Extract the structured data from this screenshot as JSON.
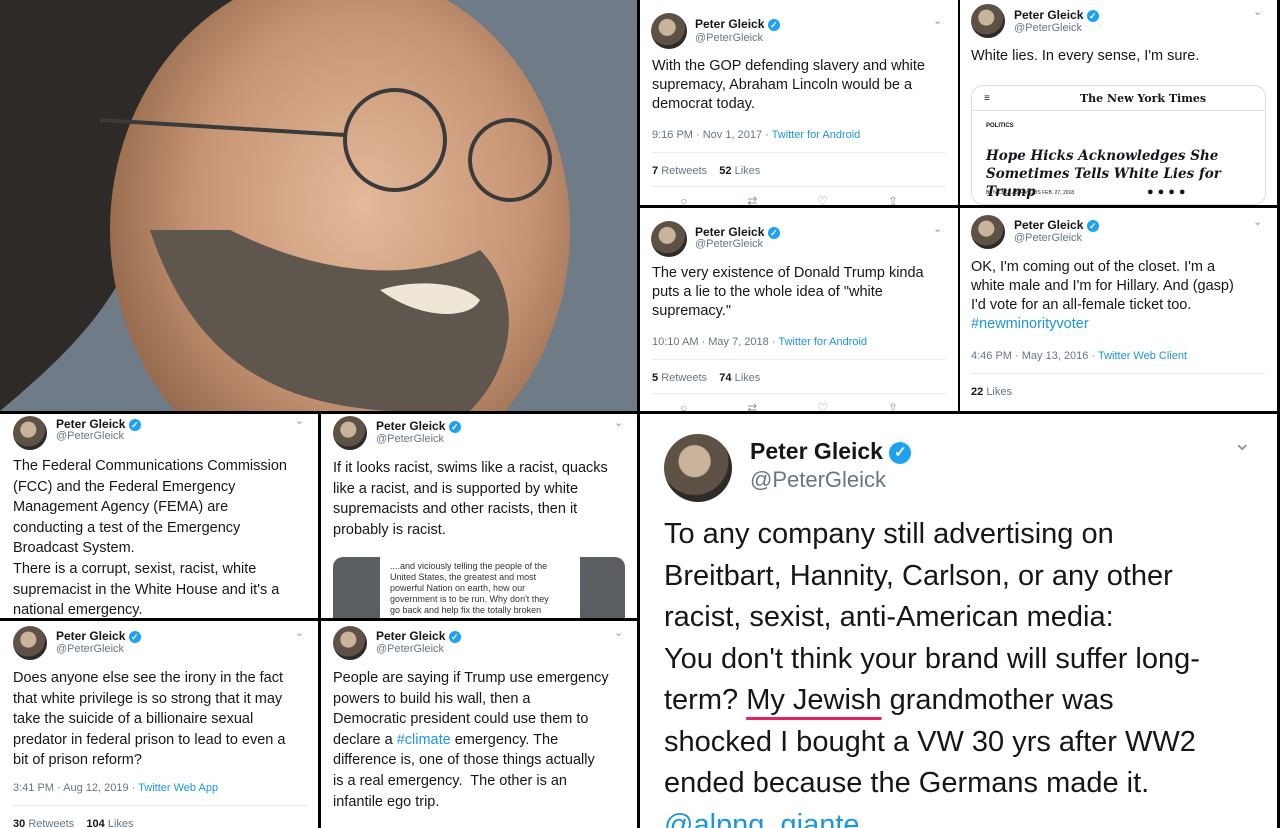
{
  "colors": {
    "accent": "#1da1f2",
    "link": "#1b95e0",
    "muted": "#657786",
    "underline": "#e0245e"
  },
  "user": {
    "name": "Peter Gleick",
    "handle": "@PeterGleick"
  },
  "tweets": {
    "t1": {
      "text": "With the GOP defending slavery and white\nsupremacy, Abraham Lincoln would be a\ndemocrat today.",
      "time": "9:16 PM · Nov 1, 2017 · ",
      "source": "Twitter for Android",
      "retweets": "7",
      "retweets_label": "Retweets",
      "likes": "52",
      "likes_label": "Likes"
    },
    "t2": {
      "text": "White lies. In every sense, I'm sure.",
      "card": {
        "menu": "≡",
        "search": "🔍",
        "masthead": "The New York Times",
        "section": "POLITICS",
        "headline": "Hope Hicks Acknowledges She Sometimes Tells White Lies for Trump",
        "byline": "By NICHOLAS FANDOS   FEB. 27, 2018"
      }
    },
    "t3": {
      "text": "The very existence of Donald Trump kinda\nputs a lie to the whole idea of \"white\nsupremacy.\"",
      "time": "10:10 AM · May 7, 2018 · ",
      "source": "Twitter for Android",
      "retweets": "5",
      "retweets_label": "Retweets",
      "likes": "74",
      "likes_label": "Likes"
    },
    "t4": {
      "text_line1": "OK, I'm coming out of the closet. I'm a",
      "text_line2": "white male and I'm for Hillary. And (gasp)",
      "text_line3": "I'd vote for an all-female ticket too.",
      "hashtag": "#newminorityvoter",
      "time": "4:46 PM · May 13, 2016 · ",
      "source": "Twitter Web Client",
      "likes": "22",
      "likes_label": "Likes"
    },
    "t5": {
      "text": "The Federal Communications Commission\n(FCC) and the Federal Emergency\nManagement Agency (FEMA) are\nconducting a test of the Emergency\nBroadcast System.\nThere is a corrupt, sexist, racist, white\nsupremacist in the White House and it's a\nnational emergency."
    },
    "t6": {
      "text": "If it looks racist, swims like a racist, quacks\nlike a racist, and is supported by white\nsupremacists and other racists, then it\nprobably is racist.",
      "quote": "....and viciously telling the people of the\nUnited States, the greatest and most\npowerful Nation on earth, how our\ngovernment is to be run. Why don't they\ngo back and help fix the totally broken"
    },
    "t7": {
      "text": "Does anyone else see the irony in the fact\nthat white privilege is so strong that it may\ntake the suicide of a billionaire sexual\npredator in federal prison to lead to even a\nbit of prison reform?",
      "time": "3:41 PM · Aug 12, 2019 · ",
      "source": "Twitter Web App",
      "retweets": "30",
      "retweets_label": "Retweets",
      "likes": "104",
      "likes_label": "Likes"
    },
    "t8": {
      "text_a": "People are saying if Trump use emergency\npowers to build his wall, then a\nDemocratic president could use them to\ndeclare a ",
      "hashtag": "#climate",
      "text_b": " emergency. The\ndifference is, one of those things actually\nis a real emergency.  The other is an\ninfantile ego trip."
    },
    "t9": {
      "text_a": "To any company still advertising on\nBreitbart, Hannity, Carlson, or any other\nracist, sexist, anti-American media:\nYou don't think your brand will suffer long-\nterm? ",
      "underlined": "My Jewish",
      "text_b": " grandmother was\nshocked I bought a VW 30 yrs after WW2\nended because the Germans made it.",
      "mention": "@alpng_giante"
    }
  }
}
